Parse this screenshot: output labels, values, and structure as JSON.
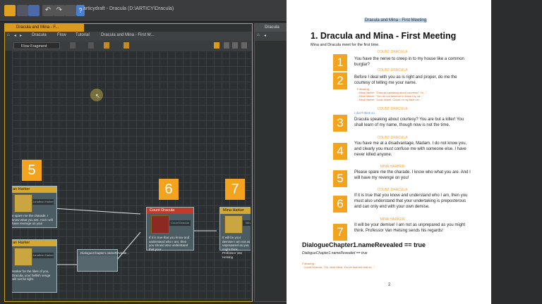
{
  "window": {
    "title": "articydraft - Dracula (D:\\ARTICY\\Dracula)"
  },
  "left_panel": {
    "tab_label": "Dracula and Mina - F...",
    "breadcrumbs": [
      "Dracula",
      "Flow",
      "Tutorial",
      "Dracula and Mina - First M..."
    ],
    "flow_select": "Flow Fragment",
    "nodes": [
      {
        "badge": "5",
        "header": "an Harker",
        "speaker": "Jonathan Harker",
        "text": "e spare me the charade. I know what you are. And I will have revenge on you!",
        "accent": "#d6a830"
      },
      {
        "badge": "6",
        "header": "Count Dracula",
        "speaker": "Count Dracula",
        "text": "If it is true that you know and understand who I am, then you should also understand that your",
        "accent": "#c23a2a"
      },
      {
        "badge": "7",
        "header": "Mina Harker",
        "speaker": "Mina Harker",
        "text": "It will be your demise! I am not as unprepared as you might think. Professor Van Helsing",
        "accent": "#d6a830"
      },
      {
        "badge": "",
        "header": "an Harker",
        "speaker": "Jonathan Harker",
        "text": "Harker for the likes of you, Dracula, your hellish venge will not be tight.",
        "accent": "#d6a830"
      },
      {
        "badge": "",
        "header": "DialogueChapter1.nameReveale...",
        "speaker": "",
        "text": "",
        "accent": "#9fb6bd"
      }
    ]
  },
  "right_panel": {
    "tab_label": "Dracula"
  },
  "document": {
    "header": "Dracula and Mina - First Meeting",
    "heading": "1.   Dracula and Mina - First Meeting",
    "intro": "Mina and Dracula meet for the first time.",
    "blocks": [
      {
        "badge": "1",
        "speaker": "COUNT DRACULA",
        "text": "You have the nerve to creep in to my house like a common burglar?"
      },
      {
        "badge": "2",
        "speaker": "COUNT DRACULA",
        "text": "Before I deal with you as is right and proper, do me the courtesy of telling me your name."
      },
      {
        "badge": "3",
        "speaker": "COUNT DRACULA",
        "text": "Dracula speaking about courtesy? You are but a killer! You shall learn of my name, though now is not the time."
      },
      {
        "badge": "4",
        "speaker": "COUNT DRACULA",
        "text": "You have me at a disadvantage, Madam. I do not know you, and clearly you must confuse me with someone else. I have never killed anyone."
      },
      {
        "badge": "5",
        "speaker": "MINA HARKER",
        "text": "Please spare me the charade. I know who what you are. And I will have my revenge on you!"
      },
      {
        "badge": "6",
        "speaker": "COUNT DRACULA",
        "text": "If it is true that you know and understand who I am, then you must also understand that your undertaking is preposterous and can only end with your own demise."
      },
      {
        "badge": "7",
        "speaker": "MINA HARKER",
        "text": "It will be your demise! I am not as unprepared as you might think. Professor Van Helsing sends his regards!"
      }
    ],
    "note_label": "Following:",
    "note_lines": [
      "- Mina Harker: \"Dracula speaking about courtesy? Yo...\"",
      "- Mina Harker: \"You do not deserve to know my na...\"",
      "- Mina Harker: \"Look closer, Count. Is my face ver..."
    ],
    "aside": "I don't think so.",
    "condition": "DialogueChapter1.nameRevealed == true",
    "condition_italic": "DialogueChapter1.nameRevealed == true",
    "following2_label": "Following:",
    "following2_line": "- Count Dracula: \"Oh, dear Mina. You've learned that so...\"",
    "page_number": "2"
  }
}
